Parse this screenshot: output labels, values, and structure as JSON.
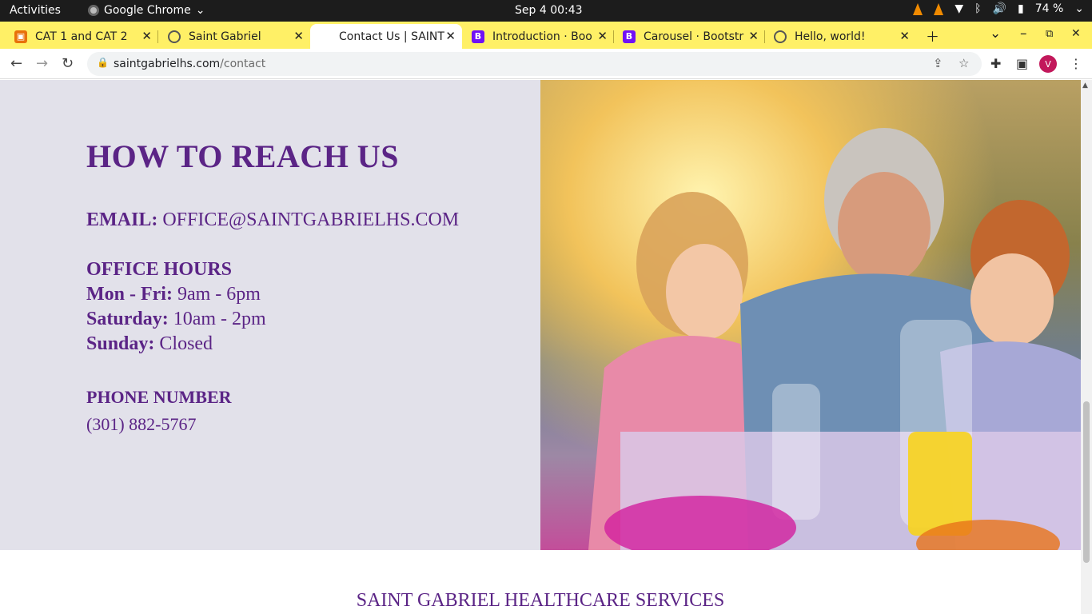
{
  "os_bar": {
    "activities": "Activities",
    "app_name": "Google Chrome",
    "clock": "Sep 4  00:43",
    "battery": "74 %"
  },
  "tabs": [
    {
      "title": "CAT 1 and CAT 2",
      "favicon": "slides-icon"
    },
    {
      "title": "Saint Gabriel",
      "favicon": "globe-icon"
    },
    {
      "title": "Contact Us | SAINT",
      "favicon": "none"
    },
    {
      "title": "Introduction · Boo",
      "favicon": "bootstrap-icon"
    },
    {
      "title": "Carousel · Bootstr",
      "favicon": "bootstrap-icon"
    },
    {
      "title": "Hello, world!",
      "favicon": "globe-icon"
    }
  ],
  "address_bar": {
    "host": "saintgabrielhs.com",
    "path": "/contact"
  },
  "profile_initial": "V",
  "contact": {
    "heading": "HOW TO REACH US",
    "email_label": "EMAIL:",
    "email_value": "OFFICE@SAINTGABRIELHS.COM",
    "hours_heading": "OFFICE HOURS",
    "weekday_label": "Mon - Fri:",
    "weekday_value": "9am - 6pm",
    "saturday_label": "Saturday:",
    "saturday_value": "10am - 2pm",
    "sunday_label": "Sunday:",
    "sunday_value": "Closed",
    "phone_heading": "PHONE NUMBER",
    "phone_value": "(301) 882-5767"
  },
  "footer": {
    "title": "SAINT GABRIEL HEALTHCARE SERVICES"
  },
  "colors": {
    "accent_purple": "#5b2486",
    "panel_bg": "#e2e1ea",
    "tabstrip_bg": "#fff066"
  }
}
